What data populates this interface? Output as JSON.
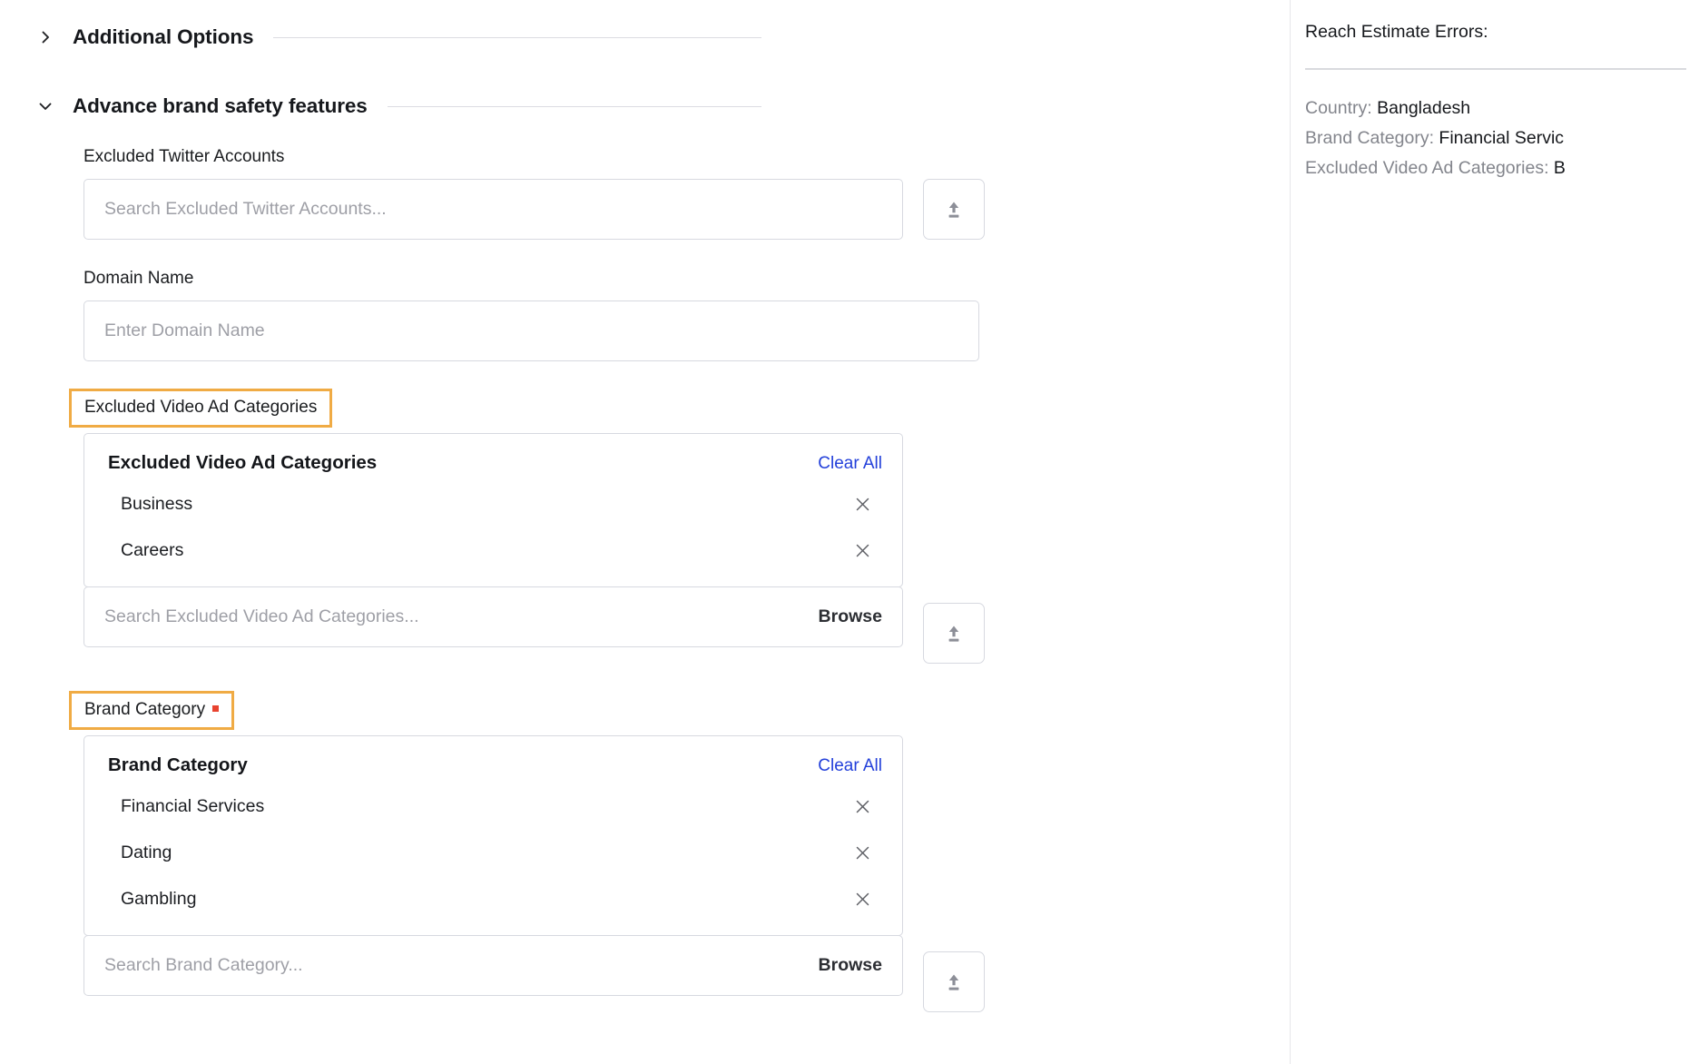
{
  "sections": [
    {
      "title": "Additional Options",
      "icon": "chevron-right-icon",
      "expanded": false
    },
    {
      "title": "Advance brand safety features",
      "icon": "chevron-down-icon",
      "expanded": true
    }
  ],
  "fields": {
    "excluded_twitter_accounts": {
      "label": "Excluded Twitter Accounts",
      "placeholder": "Search Excluded Twitter Accounts...",
      "upload_icon": "upload-icon"
    },
    "domain_name": {
      "label": "Domain Name",
      "placeholder": "Enter Domain Name"
    },
    "excluded_video_ad_categories": {
      "label": "Excluded Video Ad Categories",
      "highlighted": true,
      "panel_title": "Excluded Video Ad Categories",
      "clear_all_label": "Clear All",
      "items": [
        "Business",
        "Careers"
      ],
      "placeholder": "Search Excluded Video Ad Categories...",
      "browse_label": "Browse",
      "upload_icon": "upload-icon"
    },
    "brand_category": {
      "label": "Brand Category",
      "required": true,
      "highlighted": true,
      "panel_title": "Brand Category",
      "clear_all_label": "Clear All",
      "items": [
        "Financial Services",
        "Dating",
        "Gambling"
      ],
      "placeholder": "Search Brand Category...",
      "browse_label": "Browse",
      "upload_icon": "upload-icon"
    }
  },
  "right_panel": {
    "title": "Reach Estimate Errors:",
    "entries": [
      {
        "key": "Country:",
        "value": "Bangladesh"
      },
      {
        "key": "Brand Category:",
        "value": "Financial Servic"
      },
      {
        "key": "Excluded Video Ad Categories:",
        "value": "B"
      }
    ]
  },
  "colors": {
    "highlight_outline": "#f0ab44",
    "link_blue": "#2340da",
    "required_red": "#e8432f",
    "border_gray": "#d7d9e0",
    "placeholder_gray": "#9e9fa6"
  }
}
